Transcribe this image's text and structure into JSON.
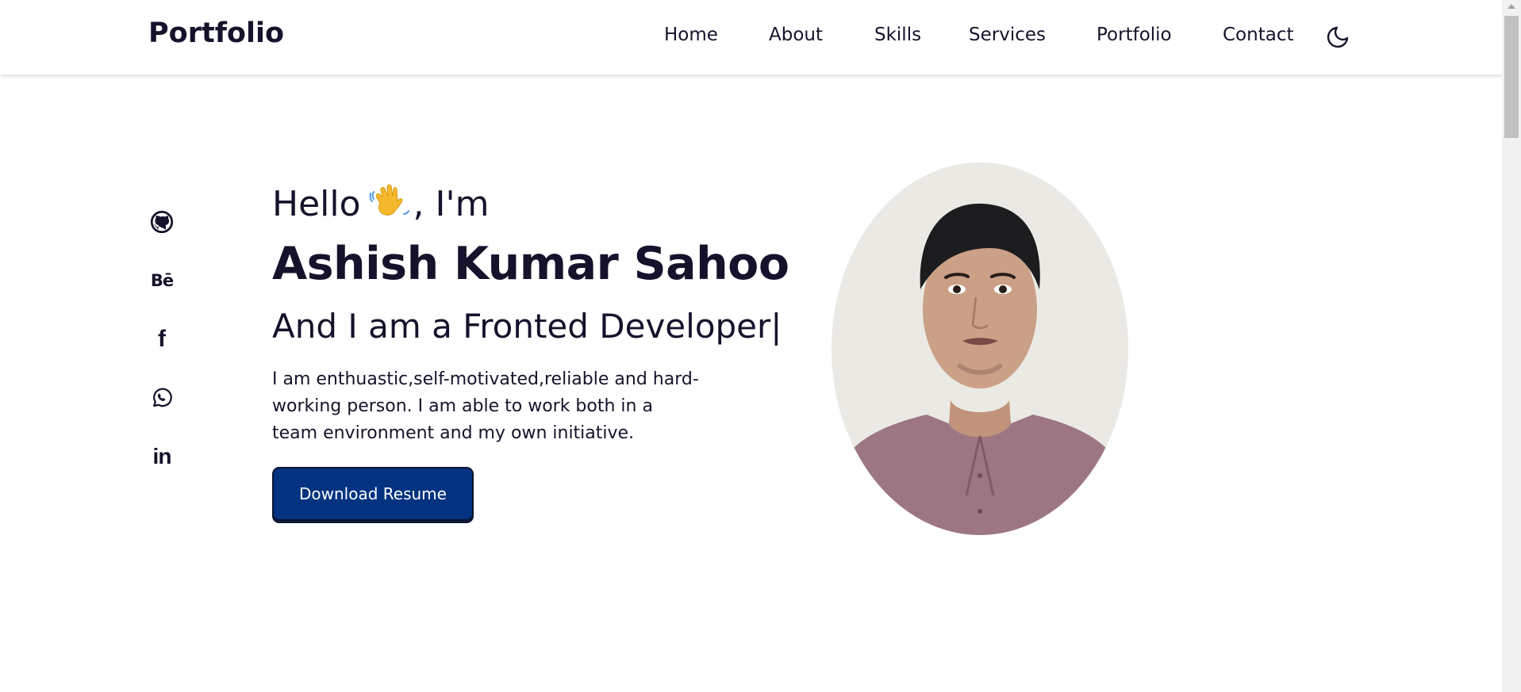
{
  "header": {
    "logo": "Portfolio",
    "nav": [
      {
        "label": "Home"
      },
      {
        "label": "About"
      },
      {
        "label": "Skills"
      },
      {
        "label": "Services"
      },
      {
        "label": "Portfolio"
      },
      {
        "label": "Contact"
      }
    ],
    "theme_toggle_icon": "moon-icon"
  },
  "social": [
    {
      "icon": "github-icon"
    },
    {
      "icon": "behance-icon",
      "text": "Bē"
    },
    {
      "icon": "facebook-icon",
      "text": "f"
    },
    {
      "icon": "whatsapp-icon"
    },
    {
      "icon": "linkedin-icon",
      "text": "in"
    }
  ],
  "hero": {
    "greeting_prefix": "Hello",
    "greeting_suffix": ", I'm",
    "wave_icon": "waving-hand-icon",
    "name": "Ashish Kumar Sahoo",
    "role": "And I am a Fronted Developer|",
    "description": "I am enthuastic,self-motivated,reliable and hard-working person. I am able to work both in a team environment and my own initiative.",
    "button_label": "Download Resume"
  },
  "colors": {
    "text": "#15132b",
    "button_bg": "#033380",
    "button_text": "#ffffff",
    "background": "#ffffff"
  }
}
